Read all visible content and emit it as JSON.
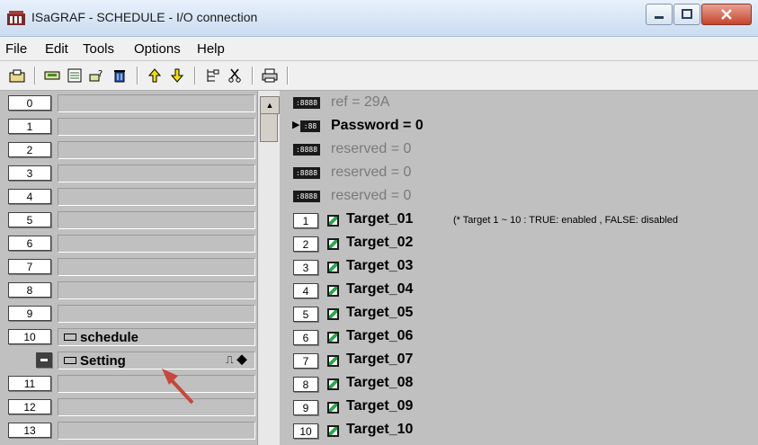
{
  "window": {
    "title": "ISaGRAF - SCHEDULE - I/O connection"
  },
  "menu": {
    "items": [
      "File",
      "Edit",
      "Tools",
      "Options",
      "Help"
    ]
  },
  "toolbar": {
    "icons": [
      "open-icon",
      "connect-icon",
      "library-icon",
      "parameters-icon",
      "delete-icon",
      "move-up-icon",
      "move-down-icon",
      "tree-icon",
      "cut-icon",
      "print-icon"
    ]
  },
  "left_list": {
    "rows": [
      {
        "num": "0",
        "label": ""
      },
      {
        "num": "1",
        "label": ""
      },
      {
        "num": "2",
        "label": ""
      },
      {
        "num": "3",
        "label": ""
      },
      {
        "num": "4",
        "label": ""
      },
      {
        "num": "5",
        "label": ""
      },
      {
        "num": "6",
        "label": ""
      },
      {
        "num": "7",
        "label": ""
      },
      {
        "num": "8",
        "label": ""
      },
      {
        "num": "9",
        "label": ""
      },
      {
        "num": "10",
        "label": "schedule"
      },
      {
        "num": "",
        "label": "Setting"
      },
      {
        "num": "11",
        "label": ""
      },
      {
        "num": "12",
        "label": ""
      },
      {
        "num": "13",
        "label": ""
      }
    ]
  },
  "right_list": {
    "header_rows": [
      {
        "text": "ref = 29A"
      },
      {
        "text": "Password = 0"
      },
      {
        "text": "reserved = 0"
      },
      {
        "text": "reserved = 0"
      },
      {
        "text": "reserved = 0"
      }
    ],
    "targets": [
      {
        "num": "1",
        "name": "Target_01",
        "comment": "(* Target 1 ~ 10 : TRUE: enabled , FALSE: disabled"
      },
      {
        "num": "2",
        "name": "Target_02"
      },
      {
        "num": "3",
        "name": "Target_03"
      },
      {
        "num": "4",
        "name": "Target_04"
      },
      {
        "num": "5",
        "name": "Target_05"
      },
      {
        "num": "6",
        "name": "Target_06"
      },
      {
        "num": "7",
        "name": "Target_07"
      },
      {
        "num": "8",
        "name": "Target_08"
      },
      {
        "num": "9",
        "name": "Target_09"
      },
      {
        "num": "10",
        "name": "Target_10"
      }
    ]
  },
  "colors": {
    "background": "#c0c0c0",
    "disabled_text": "#7a7a7a",
    "annotation_arrow": "#c8463c"
  }
}
